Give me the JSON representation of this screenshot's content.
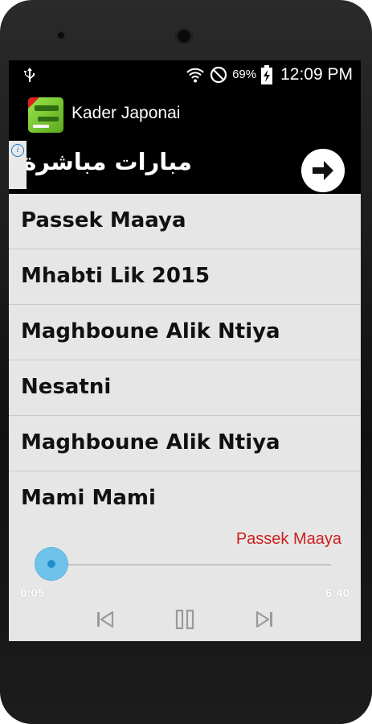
{
  "status_bar": {
    "battery_percent": "69%",
    "time": "12:09 PM",
    "icons": [
      "usb-icon",
      "wifi-icon",
      "do-not-disturb-icon",
      "battery-charging-icon"
    ]
  },
  "app_bar": {
    "title": "Kader Japonai",
    "icon": "app-icon"
  },
  "ad_banner": {
    "text": "مبارات مباشرة",
    "info_icon": "info-icon",
    "arrow_icon": "arrow-right-icon"
  },
  "songs": [
    {
      "title": "Passek Maaya"
    },
    {
      "title": "Mhabti Lik 2015"
    },
    {
      "title": "Maghboune Alik Ntiya"
    },
    {
      "title": "Nesatni"
    },
    {
      "title": "Maghboune Alik Ntiya"
    },
    {
      "title": "Mami Mami"
    }
  ],
  "player": {
    "now_playing": "Passek Maaya",
    "elapsed": "0:05",
    "duration": "6:40",
    "progress_fraction": 0.0125,
    "controls": [
      "previous-icon",
      "pause-icon",
      "next-icon"
    ],
    "accent_color": "#2b9ed8",
    "now_playing_color": "#cc1f1f"
  }
}
